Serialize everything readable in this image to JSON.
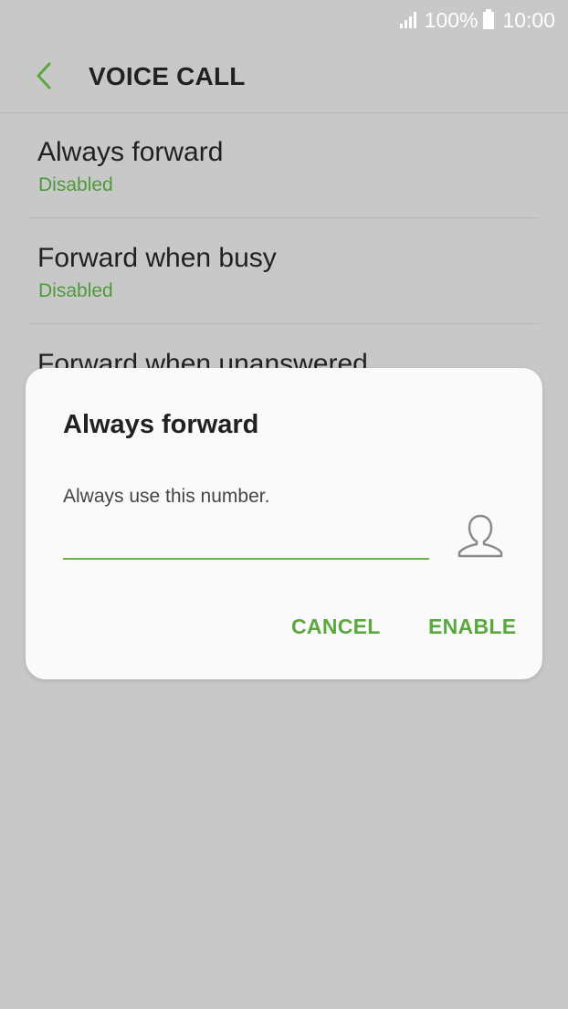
{
  "status_bar": {
    "battery": "100%",
    "time": "10:00"
  },
  "header": {
    "title": "VOICE CALL"
  },
  "list": {
    "items": [
      {
        "title": "Always forward",
        "status": "Disabled"
      },
      {
        "title": "Forward when busy",
        "status": "Disabled"
      },
      {
        "title": "Forward when unanswered"
      }
    ]
  },
  "dialog": {
    "title": "Always forward",
    "message": "Always use this number.",
    "input_value": "",
    "cancel_label": "CANCEL",
    "enable_label": "ENABLE"
  },
  "colors": {
    "accent": "#5aa840",
    "background": "#c8c8c8",
    "dialog": "#fafafa"
  },
  "icons": {
    "back": "chevron-left-icon",
    "contact": "contact-person-icon",
    "signal": "signal-icon",
    "battery": "battery-icon"
  }
}
